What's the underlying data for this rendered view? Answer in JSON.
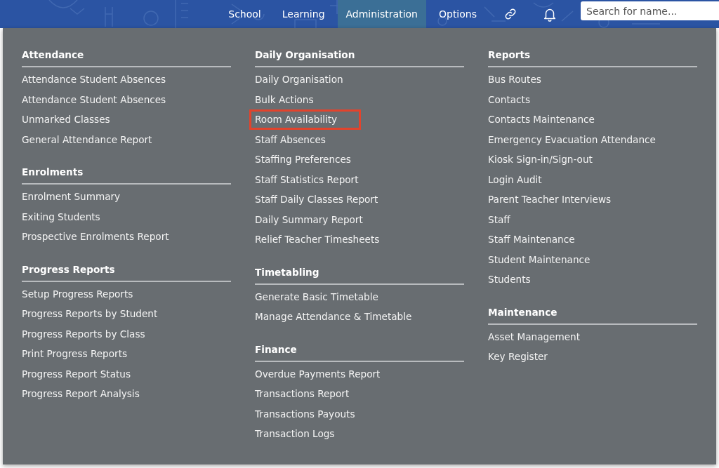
{
  "nav": {
    "items": [
      {
        "label": "School",
        "selected": false
      },
      {
        "label": "Learning",
        "selected": false
      },
      {
        "label": "Administration",
        "selected": true
      },
      {
        "label": "Options",
        "selected": false
      }
    ],
    "search": {
      "placeholder": "Search for name..."
    }
  },
  "menu": {
    "columns": [
      {
        "sections": [
          {
            "heading": "Attendance",
            "items": [
              {
                "label": "Attendance Student Absences",
                "highlighted": false
              },
              {
                "label": "Attendance Student Absences",
                "highlighted": false
              },
              {
                "label": "Unmarked Classes",
                "highlighted": false
              },
              {
                "label": "General Attendance Report",
                "highlighted": false
              }
            ]
          },
          {
            "heading": "Enrolments",
            "items": [
              {
                "label": "Enrolment Summary",
                "highlighted": false
              },
              {
                "label": "Exiting Students",
                "highlighted": false
              },
              {
                "label": "Prospective Enrolments Report",
                "highlighted": false
              }
            ]
          },
          {
            "heading": "Progress Reports",
            "items": [
              {
                "label": "Setup Progress Reports",
                "highlighted": false
              },
              {
                "label": "Progress Reports by Student",
                "highlighted": false
              },
              {
                "label": "Progress Reports by Class",
                "highlighted": false
              },
              {
                "label": "Print Progress Reports",
                "highlighted": false
              },
              {
                "label": "Progress Report Status",
                "highlighted": false
              },
              {
                "label": "Progress Report Analysis",
                "highlighted": false
              }
            ]
          }
        ]
      },
      {
        "sections": [
          {
            "heading": "Daily Organisation",
            "items": [
              {
                "label": "Daily Organisation",
                "highlighted": false
              },
              {
                "label": "Bulk Actions",
                "highlighted": false
              },
              {
                "label": "Room Availability",
                "highlighted": true
              },
              {
                "label": "Staff Absences",
                "highlighted": false
              },
              {
                "label": "Staffing Preferences",
                "highlighted": false
              },
              {
                "label": "Staff Statistics Report",
                "highlighted": false
              },
              {
                "label": "Staff Daily Classes Report",
                "highlighted": false
              },
              {
                "label": "Daily Summary Report",
                "highlighted": false
              },
              {
                "label": "Relief Teacher Timesheets",
                "highlighted": false
              }
            ]
          },
          {
            "heading": "Timetabling",
            "items": [
              {
                "label": "Generate Basic Timetable",
                "highlighted": false
              },
              {
                "label": "Manage Attendance & Timetable",
                "highlighted": false
              }
            ]
          },
          {
            "heading": "Finance",
            "items": [
              {
                "label": "Overdue Payments Report",
                "highlighted": false
              },
              {
                "label": "Transactions Report",
                "highlighted": false
              },
              {
                "label": "Transactions Payouts",
                "highlighted": false
              },
              {
                "label": "Transaction Logs",
                "highlighted": false
              }
            ]
          }
        ]
      },
      {
        "sections": [
          {
            "heading": "Reports",
            "items": [
              {
                "label": "Bus Routes",
                "highlighted": false
              },
              {
                "label": "Contacts",
                "highlighted": false
              },
              {
                "label": "Contacts Maintenance",
                "highlighted": false
              },
              {
                "label": "Emergency Evacuation Attendance",
                "highlighted": false
              },
              {
                "label": "Kiosk Sign-in/Sign-out",
                "highlighted": false
              },
              {
                "label": "Login Audit",
                "highlighted": false
              },
              {
                "label": "Parent Teacher Interviews",
                "highlighted": false
              },
              {
                "label": "Staff",
                "highlighted": false
              },
              {
                "label": "Staff Maintenance",
                "highlighted": false
              },
              {
                "label": "Student Maintenance",
                "highlighted": false
              },
              {
                "label": "Students",
                "highlighted": false
              }
            ]
          },
          {
            "heading": "Maintenance",
            "items": [
              {
                "label": "Asset Management",
                "highlighted": false
              },
              {
                "label": "Key Register",
                "highlighted": false
              }
            ]
          }
        ]
      }
    ]
  }
}
